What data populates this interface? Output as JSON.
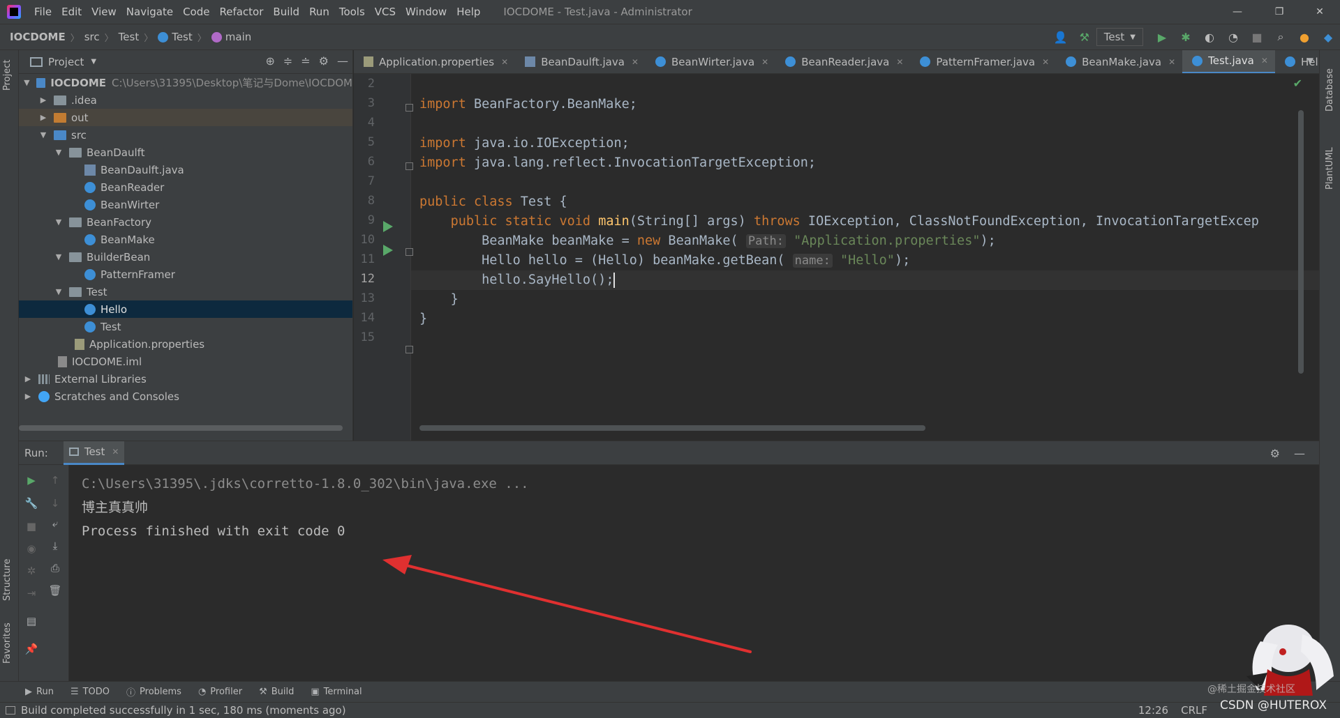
{
  "menu": {
    "items": [
      "File",
      "Edit",
      "View",
      "Navigate",
      "Code",
      "Refactor",
      "Build",
      "Run",
      "Tools",
      "VCS",
      "Window",
      "Help"
    ],
    "window_title": "IOCDOME - Test.java - Administrator"
  },
  "window_controls": {
    "minimize": "—",
    "restore": "❐",
    "close": "✕"
  },
  "breadcrumb": {
    "project": "IOCDOME",
    "src": "src",
    "package": "Test",
    "class": "Test",
    "method": "main"
  },
  "run_config": {
    "label": "Test"
  },
  "project_panel": {
    "title": "Project",
    "tree": [
      {
        "label": "IOCDOME",
        "path": "C:\\Users\\31395\\Desktop\\笔记与Dome\\IOCDOM"
      },
      {
        "label": ".idea"
      },
      {
        "label": "out"
      },
      {
        "label": "src"
      },
      {
        "label": "BeanDaulft"
      },
      {
        "label": "BeanDaulft.java"
      },
      {
        "label": "BeanReader"
      },
      {
        "label": "BeanWirter"
      },
      {
        "label": "BeanFactory"
      },
      {
        "label": "BeanMake"
      },
      {
        "label": "BuilderBean"
      },
      {
        "label": "PatternFramer"
      },
      {
        "label": "Test"
      },
      {
        "label": "Hello"
      },
      {
        "label": "Test"
      },
      {
        "label": "Application.properties"
      },
      {
        "label": "IOCDOME.iml"
      },
      {
        "label": "External Libraries"
      },
      {
        "label": "Scratches and Consoles"
      }
    ]
  },
  "left_stripe": {
    "project": "Project",
    "structure": "Structure",
    "favorites": "Favorites"
  },
  "right_stripe": {
    "database": "Database",
    "plantuml": "PlantUML"
  },
  "tabs": [
    {
      "label": "Application.properties"
    },
    {
      "label": "BeanDaulft.java"
    },
    {
      "label": "BeanWirter.java"
    },
    {
      "label": "BeanReader.java"
    },
    {
      "label": "PatternFramer.java"
    },
    {
      "label": "BeanMake.java"
    },
    {
      "label": "Test.java"
    },
    {
      "label": "Hello.jav"
    }
  ],
  "editor": {
    "line_numbers": [
      "2",
      "3",
      "4",
      "5",
      "6",
      "7",
      "8",
      "9",
      "10",
      "11",
      "12",
      "13",
      "14",
      "15"
    ],
    "code": {
      "l3_kw": "import",
      "l3_rest": " BeanFactory.BeanMake;",
      "l5_kw": "import",
      "l5_rest": " java.io.IOException;",
      "l6_kw": "import",
      "l6_rest": " java.lang.reflect.InvocationTargetException;",
      "l8_kw": "public class",
      "l8_rest": " Test {",
      "l9_kw": "public static void",
      "l9_fn": "main",
      "l9_mid": "(String[] args) ",
      "l9_throws": "throws",
      "l9_rest": " IOException, ClassNotFoundException, InvocationTargetExcep",
      "l10_a": "BeanMake beanMake = ",
      "l10_new": "new",
      "l10_b": " BeanMake(",
      "l10_hint": "Path:",
      "l10_str": "\"Application.properties\"",
      "l10_end": ");",
      "l11_a": "Hello hello = (Hello) beanMake.getBean(",
      "l11_hint": "name:",
      "l11_str": "\"Hello\"",
      "l11_end": ");",
      "l12": "hello.SayHello();",
      "l13": "}",
      "l14": "}"
    }
  },
  "run_panel": {
    "title": "Run:",
    "tab_label": "Test",
    "console": {
      "line1": "C:\\Users\\31395\\.jdks\\corretto-1.8.0_302\\bin\\java.exe ...",
      "line2": "博主真真帅",
      "line3": "",
      "line4": "Process finished with exit code 0"
    }
  },
  "bottom_tools": [
    {
      "label": "Run"
    },
    {
      "label": "TODO"
    },
    {
      "label": "Problems"
    },
    {
      "label": "Profiler"
    },
    {
      "label": "Build"
    },
    {
      "label": "Terminal"
    }
  ],
  "status": {
    "message": "Build completed successfully in 1 sec, 180 ms (moments ago)",
    "position": "12:26",
    "line_sep": "CRLF"
  },
  "watermarks": {
    "top": "@稀土掘金技术社区",
    "bottom": "CSDN @HUTEROX"
  },
  "colors": {
    "keyword": "#cc7832",
    "string": "#6a8759",
    "function": "#ffc66d",
    "run_green": "#59a869",
    "accent_blue": "#4a88c7",
    "annotation_red": "#e03030"
  }
}
